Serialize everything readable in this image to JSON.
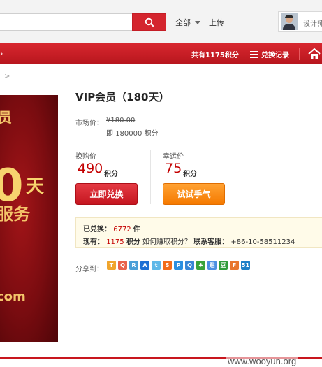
{
  "header": {
    "search_placeholder": "",
    "scope_label": "全部",
    "upload_label": "上传",
    "user_label": "设计师"
  },
  "nav": {
    "arrow": "›",
    "points_total": "共有1175积分",
    "history_label": "兑换记录"
  },
  "breadcrumb": ">",
  "product": {
    "image_text": {
      "line1": "员",
      "big": "0",
      "days": "天",
      "service": "服务",
      "domain": "com"
    },
    "title": "VIP会员（180天）",
    "market_label": "市场价：",
    "market_price": "¥180.00",
    "equiv_prefix": "即",
    "equiv_points": "180000",
    "equiv_suffix": "积分"
  },
  "pricing": {
    "exchange_label": "换购价",
    "exchange_value": "490",
    "exchange_unit": "积分",
    "lucky_label": "幸运价",
    "lucky_value": "75",
    "lucky_unit": "积分"
  },
  "buttons": {
    "redeem": "立即兑换",
    "lucky": "试试手气"
  },
  "info": {
    "redeemed_label": "已兑换：",
    "redeemed_count": "6772",
    "redeemed_unit": "件",
    "current_label": "现有：",
    "current_points": "1175",
    "current_unit": "积分",
    "earn_link": "如何赚取积分？",
    "service_label": "联系客服：",
    "service_phone": "+86-10-58511234"
  },
  "share": {
    "label": "分享到：",
    "icons": [
      {
        "name": "sina-weibo-icon",
        "color": "#f0a52c",
        "glyph": "T"
      },
      {
        "name": "qq-zone-icon",
        "color": "#e8624a",
        "glyph": "Q"
      },
      {
        "name": "renren-icon",
        "color": "#4a9fd8",
        "glyph": "R"
      },
      {
        "name": "kaixin-icon",
        "color": "#1c6fd4",
        "glyph": "A"
      },
      {
        "name": "tencent-icon",
        "color": "#5fb8e8",
        "glyph": "t"
      },
      {
        "name": "sohu-icon",
        "color": "#f26c1a",
        "glyph": "S"
      },
      {
        "name": "baidu-icon",
        "color": "#2d8fe0",
        "glyph": "P"
      },
      {
        "name": "qq-icon",
        "color": "#3a86d6",
        "glyph": "Q"
      },
      {
        "name": "clover-icon",
        "color": "#3aa33a",
        "glyph": "♣"
      },
      {
        "name": "tieba-icon",
        "color": "#4b8fe2",
        "glyph": "贴"
      },
      {
        "name": "douban-icon",
        "color": "#2f9b3a",
        "glyph": "豆"
      },
      {
        "name": "fetion-icon",
        "color": "#e8772e",
        "glyph": "F"
      },
      {
        "name": "51-icon",
        "color": "#1d80c8",
        "glyph": "51"
      }
    ]
  },
  "watermark": "www.wooyun.org"
}
